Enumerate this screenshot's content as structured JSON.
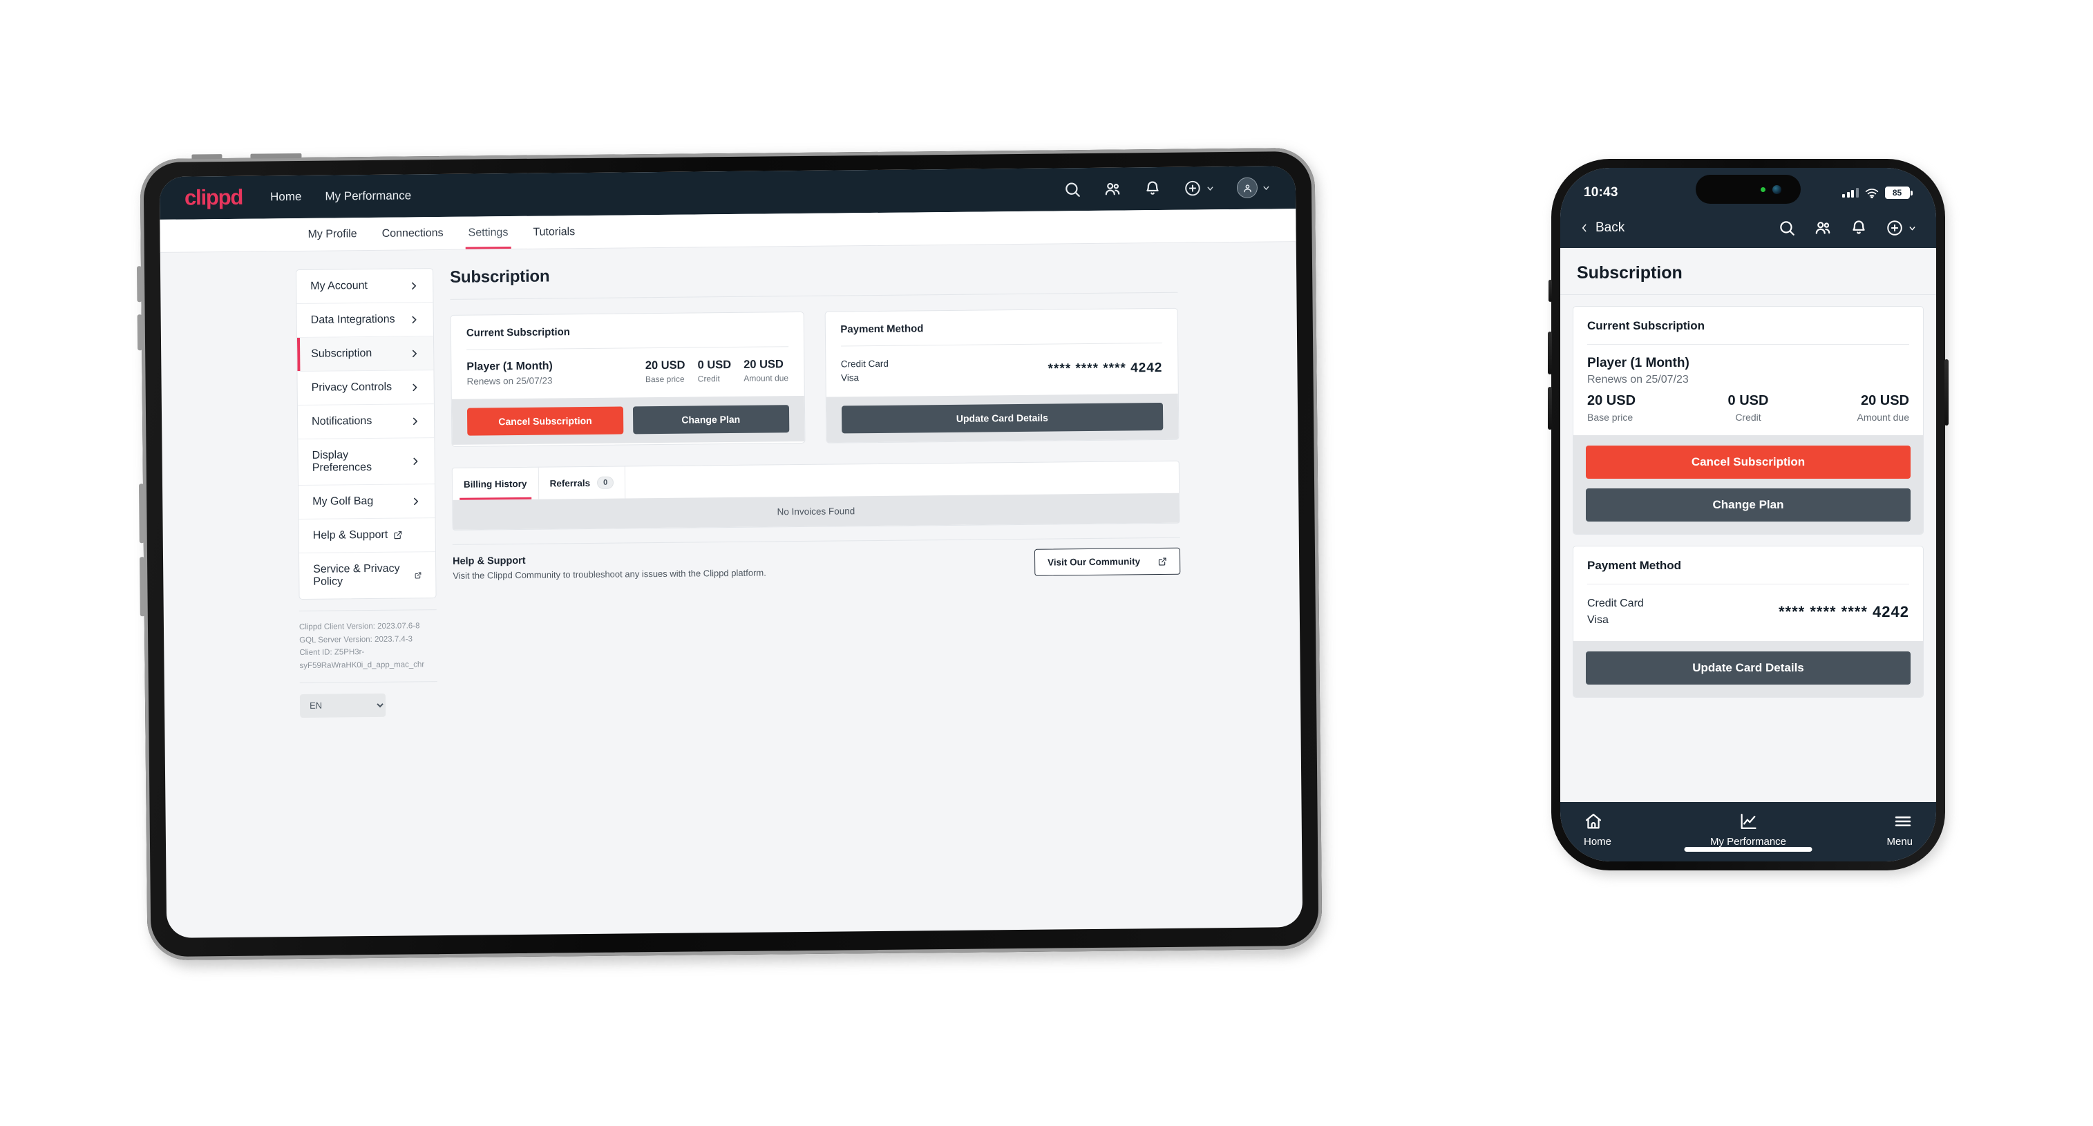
{
  "brand": {
    "name": "clippd",
    "color": "#e8365d"
  },
  "tablet": {
    "navbar": {
      "links": [
        {
          "label": "Home"
        },
        {
          "label": "My Performance"
        }
      ],
      "icons": [
        "search-icon",
        "people-icon",
        "bell-icon",
        "plus-circle-icon",
        "avatar-icon"
      ]
    },
    "subnav": {
      "tabs": [
        {
          "label": "My Profile",
          "active": false
        },
        {
          "label": "Connections",
          "active": false
        },
        {
          "label": "Settings",
          "active": true
        },
        {
          "label": "Tutorials",
          "active": false
        }
      ]
    },
    "settings_menu": [
      {
        "label": "My Account",
        "type": "chevron",
        "active": false
      },
      {
        "label": "Data Integrations",
        "type": "chevron",
        "active": false
      },
      {
        "label": "Subscription",
        "type": "chevron",
        "active": true
      },
      {
        "label": "Privacy Controls",
        "type": "chevron",
        "active": false
      },
      {
        "label": "Notifications",
        "type": "chevron",
        "active": false
      },
      {
        "label": "Display Preferences",
        "type": "chevron",
        "active": false
      },
      {
        "label": "My Golf Bag",
        "type": "chevron",
        "active": false
      },
      {
        "label": "Help & Support",
        "type": "external",
        "active": false
      },
      {
        "label": "Service & Privacy Policy",
        "type": "external",
        "active": false
      }
    ],
    "version_info": {
      "client_version": "Clippd Client Version: 2023.07.6-8",
      "server_version": "GQL Server Version: 2023.7.4-3",
      "client_id": "Client ID: Z5PH3r-syF59RaWraHK0i_d_app_mac_chr"
    },
    "language": {
      "value": "EN",
      "options": [
        "EN"
      ]
    },
    "page_title": "Subscription",
    "current_subscription": {
      "card_title": "Current Subscription",
      "plan_name": "Player (1 Month)",
      "renews": "Renews on 25/07/23",
      "base_price_value": "20 USD",
      "base_price_label": "Base price",
      "credit_value": "0 USD",
      "credit_label": "Credit",
      "amount_due_value": "20 USD",
      "amount_due_label": "Amount due",
      "cancel_label": "Cancel Subscription",
      "change_plan_label": "Change Plan"
    },
    "payment_method": {
      "card_title": "Payment Method",
      "type": "Credit Card",
      "brand": "Visa",
      "number": "**** **** **** 4242",
      "update_label": "Update Card Details"
    },
    "billing": {
      "tabs": [
        {
          "label": "Billing History",
          "badge": null,
          "active": true
        },
        {
          "label": "Referrals",
          "badge": "0",
          "active": false
        }
      ],
      "empty_text": "No Invoices Found"
    },
    "help": {
      "title": "Help & Support",
      "subtitle": "Visit the Clippd Community to troubleshoot any issues with the Clippd platform.",
      "button_label": "Visit Our Community"
    }
  },
  "phone": {
    "status_bar": {
      "time": "10:43",
      "battery": "85"
    },
    "appbar": {
      "back_label": "Back",
      "icons": [
        "search-icon",
        "people-icon",
        "bell-icon",
        "plus-circle-icon"
      ]
    },
    "page_title": "Subscription",
    "current_subscription": {
      "card_title": "Current Subscription",
      "plan_name": "Player (1 Month)",
      "renews": "Renews on 25/07/23",
      "base_price_value": "20 USD",
      "base_price_label": "Base price",
      "credit_value": "0 USD",
      "credit_label": "Credit",
      "amount_due_value": "20 USD",
      "amount_due_label": "Amount due",
      "cancel_label": "Cancel Subscription",
      "change_plan_label": "Change Plan"
    },
    "payment_method": {
      "card_title": "Payment Method",
      "type": "Credit Card",
      "brand": "Visa",
      "number": "**** **** **** 4242",
      "update_label": "Update Card Details"
    },
    "tabbar": [
      {
        "label": "Home",
        "icon": "home-icon"
      },
      {
        "label": "My Performance",
        "icon": "chart-icon"
      },
      {
        "label": "Menu",
        "icon": "hamburger-icon"
      }
    ]
  }
}
